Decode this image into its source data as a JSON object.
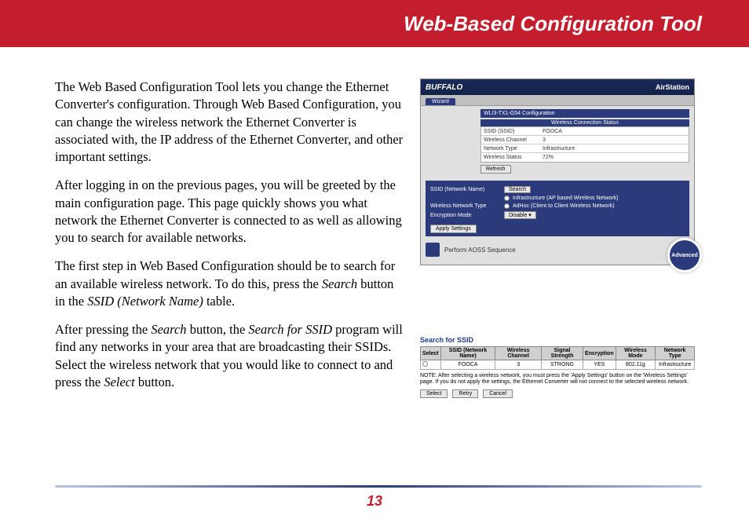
{
  "header": {
    "title": "Web-Based Configuration Tool"
  },
  "body": {
    "p1": "The Web Based Configuration Tool lets you change the Ethernet Converter's configuration. Through Web Based Configuration, you can change the wireless network the Ethernet Converter is associated with, the IP address of the Ethernet Converter, and other important settings.",
    "p2": "After logging in on the previous pages, you will be greeted by the main configuration page. This page quickly shows you what network the Ethernet Converter is connected to as well as allowing you to search for available networks.",
    "p3a": "The first step in Web Based Configuration should be to search for an available wireless network. To do this, press the ",
    "p3_search": "Search",
    "p3b": " button in the ",
    "p3_ssid": "SSID (Network Name)",
    "p3c": " table.",
    "p4a": "After pressing the ",
    "p4_search": "Search",
    "p4b": " button, the ",
    "p4_sfs": "Search for SSID",
    "p4c": " program will find any networks in your area that are broadcasting their SSIDs.  Select the wireless network that you would like to connect to and press the ",
    "p4_select": "Select",
    "p4d": " button."
  },
  "shot": {
    "brand": "BUFFALO",
    "product": "AirStation",
    "tab": "Wizard",
    "cfg_title": "WLI3-TX1-G54 Configuration",
    "status_header": "Wireless Connection Status",
    "rows": [
      {
        "l": "SSID (SSID)",
        "r": "FOOCA"
      },
      {
        "l": "Wireless Channel",
        "r": "3"
      },
      {
        "l": "Network Type",
        "r": "Infrastructure"
      },
      {
        "l": "Wireless Status",
        "r": "72%"
      }
    ],
    "refresh": "Refresh",
    "panel": {
      "ssid_label": "SSID (Network Name)",
      "search": "Search",
      "opt_infra": "Infrastructure (AP based Wireless Network)",
      "type_label": "Wireless Network Type",
      "opt_adhoc": "AdHoc (Client to Client Wireless Network)",
      "enc_label": "Encryption Mode",
      "enc_value": "Disable",
      "apply": "Apply Settings"
    },
    "aoss": "Perform AOSS Sequence",
    "advanced": "Advanced"
  },
  "search": {
    "title": "Search for SSID",
    "headers": [
      "Select",
      "SSID (Network Name)",
      "Wireless Channel",
      "Signal Strength",
      "Encryption",
      "Wireless Mode",
      "Network Type"
    ],
    "row": [
      "",
      "FOOCA",
      "3",
      "STRONG",
      "YES",
      "802.11g",
      "Infrastructure"
    ],
    "note": "NOTE: After selecting a wireless network, you must press the 'Apply Settings' button on the 'Wireless Settings' page. If you do not apply the settings, the Ethernet Converter will not connect to the selected wireless network.",
    "btn_select": "Select",
    "btn_retry": "Retry",
    "btn_cancel": "Cancel"
  },
  "page_number": "13"
}
